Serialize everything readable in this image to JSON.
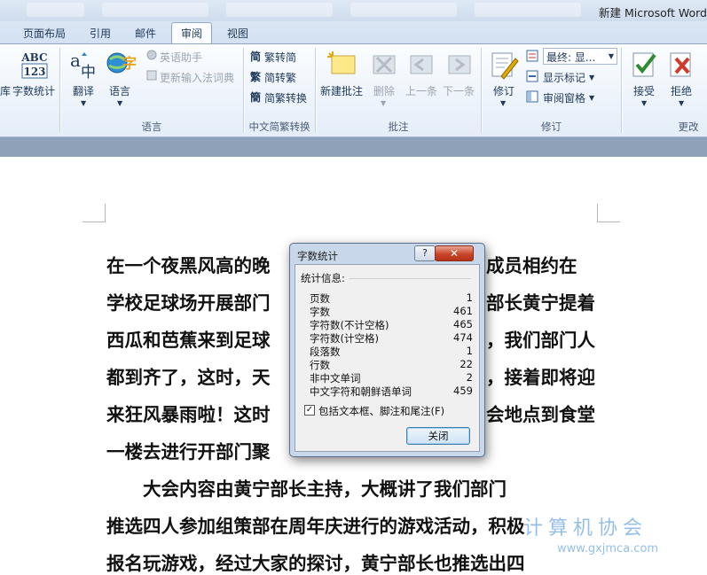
{
  "window": {
    "title": "新建 Microsoft Word"
  },
  "tabs": [
    {
      "label": "页面布局"
    },
    {
      "label": "引用"
    },
    {
      "label": "邮件"
    },
    {
      "label": "审阅",
      "active": true
    },
    {
      "label": "视图"
    }
  ],
  "ribbon": {
    "proofing": {
      "cut_label": "库",
      "wordcount_label": "字数统计",
      "wordcount_icon_text": "ABC\n123"
    },
    "language": {
      "translate_label": "翻译",
      "language_label": "语言",
      "english_assistant_label": "英语助手",
      "update_ime_label": "更新输入法词典",
      "group_label": "语言"
    },
    "chinese_conversion": {
      "to_simplified": "繁转简",
      "to_traditional": "简转繁",
      "convert": "简繁转换",
      "group_label": "中文简繁转换"
    },
    "comments": {
      "new_comment": "新建批注",
      "delete": "删除",
      "previous": "上一条",
      "next": "下一条",
      "group_label": "批注"
    },
    "tracking": {
      "track_changes": "修订",
      "display_mode_value": "最终: 显...",
      "show_markup": "显示标记",
      "reviewing_pane": "审阅窗格",
      "group_label": "修订"
    },
    "changes": {
      "accept": "接受",
      "reject": "拒绝",
      "group_label": "更改"
    }
  },
  "document": {
    "lines": [
      "在一个夜黑风高的晚",
      "学校足球场开展部门",
      "西瓜和芭蕉来到足球",
      "都到齐了，这时，天",
      "来狂风暴雨啦！这时",
      "一楼去进行开部门聚",
      "　　大会内容由黄宁部长主持，大概讲了我们部门",
      "推选四人参加组策部在周年庆进行的游戏活动，积极",
      "报名玩游戏，经过大家的探讨，黄宁部长也推选出四"
    ],
    "right_fragments": [
      "成员相约在",
      "部长黄宁提着",
      "，我们部门人",
      "，接着即将迎",
      "会地点到食堂"
    ],
    "squiggle_words": [
      "黄宁",
      "开部门"
    ]
  },
  "dialog": {
    "title": "字数统计",
    "help_label": "?",
    "close_x_label": "✕",
    "stats_caption": "统计信息:",
    "stats": [
      {
        "label": "页数",
        "value": "1"
      },
      {
        "label": "字数",
        "value": "461"
      },
      {
        "label": "字符数(不计空格)",
        "value": "465"
      },
      {
        "label": "字符数(计空格)",
        "value": "474"
      },
      {
        "label": "段落数",
        "value": "1"
      },
      {
        "label": "行数",
        "value": "22"
      },
      {
        "label": "非中文单词",
        "value": "2"
      },
      {
        "label": "中文字符和朝鲜语单词",
        "value": "459"
      }
    ],
    "include_textboxes": {
      "checked": true,
      "label": "包括文本框、脚注和尾注(F)"
    },
    "close_button_label": "关闭"
  },
  "watermark": {
    "text": "计算机协会",
    "url": "www.gxjmca.com"
  }
}
